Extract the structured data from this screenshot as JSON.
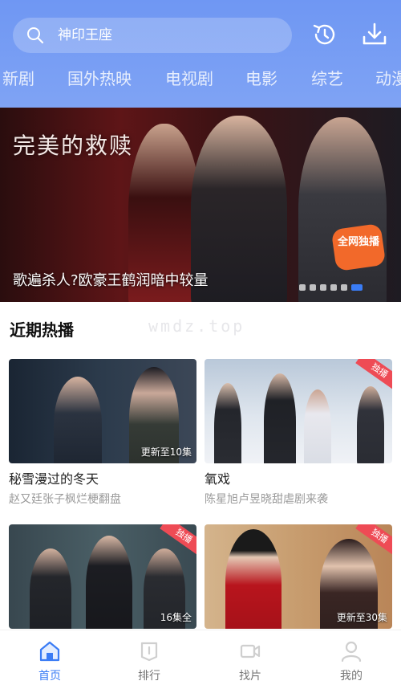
{
  "search": {
    "value": "神印王座"
  },
  "header": {
    "icons": [
      "history-icon",
      "download-icon"
    ]
  },
  "tabs": [
    {
      "label": "新剧"
    },
    {
      "label": "国外热映"
    },
    {
      "label": "电视剧"
    },
    {
      "label": "电影"
    },
    {
      "label": "综艺"
    },
    {
      "label": "动漫"
    }
  ],
  "banner": {
    "title_art": "完美的救赎",
    "caption": "歌遍杀人?欧豪王鹤润暗中较量",
    "sticker": "全网独播",
    "dots_total": 6,
    "active_dot": 5
  },
  "section": {
    "title": "近期热播"
  },
  "watermark": "wmdz.top",
  "cards": [
    {
      "name": "秘雪漫过的冬天",
      "desc": "赵又廷张子枫烂梗翻盘",
      "episodes": "更新至10集",
      "badge": ""
    },
    {
      "name": "氧戏",
      "desc": "陈星旭卢昱晓甜虐剧来袭",
      "episodes": "",
      "badge": "独播"
    },
    {
      "name": "",
      "desc": "",
      "episodes": "16集全",
      "badge": "独播"
    },
    {
      "name": "",
      "desc": "",
      "episodes": "更新至30集",
      "badge": "独播"
    }
  ],
  "nav": [
    {
      "label": "首页",
      "active": true
    },
    {
      "label": "排行",
      "active": false
    },
    {
      "label": "找片",
      "active": false
    },
    {
      "label": "我的",
      "active": false
    }
  ],
  "colors": {
    "accent": "#3a7cf5",
    "header": "#7ea2f4",
    "badge": "#ee4b55"
  }
}
